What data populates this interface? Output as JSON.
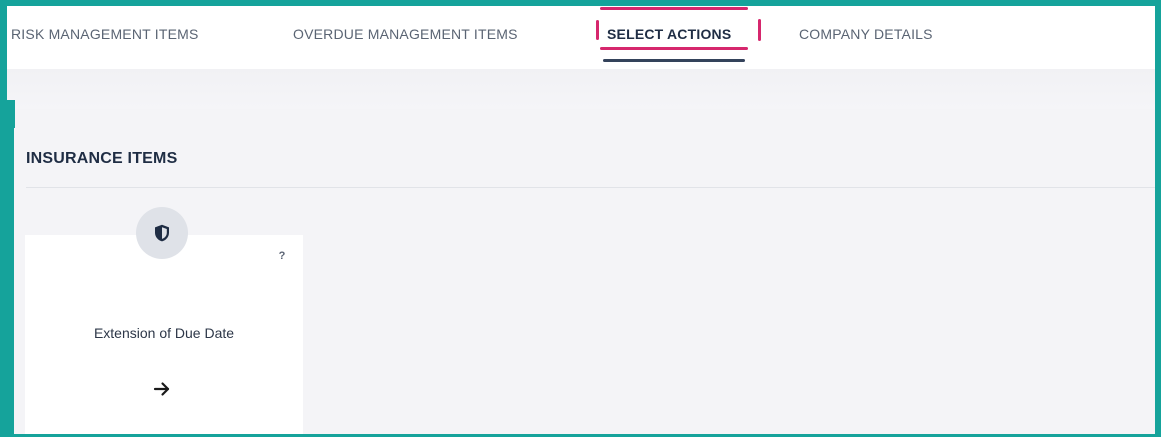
{
  "nav": {
    "tabs": [
      {
        "label": "RISK MANAGEMENT ITEMS",
        "active": false
      },
      {
        "label": "OVERDUE MANAGEMENT ITEMS",
        "active": false
      },
      {
        "label": "SELECT ACTIONS",
        "active": true
      },
      {
        "label": "COMPANY DETAILS",
        "active": false
      }
    ]
  },
  "section": {
    "title": "INSURANCE ITEMS"
  },
  "cards": [
    {
      "label": "Extension of Due Date",
      "icon": "shield-icon",
      "help_label": "?",
      "action_icon": "arrow-right-icon"
    }
  ],
  "colors": {
    "frame": "#15a39b",
    "highlight": "#d6276d",
    "active_tab_underline": "#34435b",
    "heading_text": "#1f2d44"
  }
}
